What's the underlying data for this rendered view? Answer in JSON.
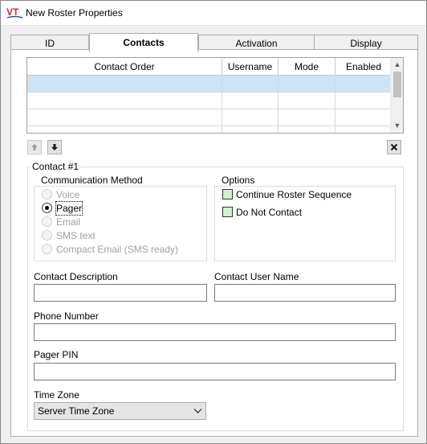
{
  "window": {
    "title": "New Roster Properties",
    "logo_text": "VT",
    "logo_color": "#d7282f"
  },
  "tabs": [
    {
      "label": "ID",
      "active": false
    },
    {
      "label": "Contacts",
      "active": true
    },
    {
      "label": "Activation",
      "active": false
    },
    {
      "label": "Display",
      "active": false
    }
  ],
  "contacts_grid": {
    "columns": [
      "Contact Order",
      "Username",
      "Mode",
      "Enabled"
    ],
    "rows": [
      {
        "selected": true
      },
      {
        "selected": false
      },
      {
        "selected": false
      },
      {
        "selected": false
      }
    ],
    "selected_row_color": "#cce4f7"
  },
  "grid_buttons": {
    "move_up_icon": "arrow-up-icon",
    "move_down_icon": "arrow-down-icon",
    "delete_icon": "close-icon"
  },
  "contact_section": {
    "title": "Contact #1",
    "communication_method": {
      "title": "Communication Method",
      "options": [
        {
          "label": "Voice",
          "checked": false,
          "enabled": false
        },
        {
          "label": "Pager",
          "checked": true,
          "enabled": true
        },
        {
          "label": "Email",
          "checked": false,
          "enabled": false
        },
        {
          "label": "SMS text",
          "checked": false,
          "enabled": false
        },
        {
          "label": "Compact Email (SMS ready)",
          "checked": false,
          "enabled": false
        }
      ]
    },
    "options": {
      "title": "Options",
      "items": [
        {
          "label": "Continue Roster Sequence",
          "checked": false
        },
        {
          "label": "Do Not Contact",
          "checked": false
        }
      ],
      "checkbox_color": "#ccf5c8"
    },
    "fields": {
      "contact_description": {
        "label": "Contact Description",
        "value": ""
      },
      "contact_user_name": {
        "label": "Contact User Name",
        "value": ""
      },
      "phone_number": {
        "label": "Phone Number",
        "value": ""
      },
      "pager_pin": {
        "label": "Pager PIN",
        "value": ""
      },
      "time_zone": {
        "label": "Time Zone",
        "value": "Server Time Zone"
      }
    }
  }
}
